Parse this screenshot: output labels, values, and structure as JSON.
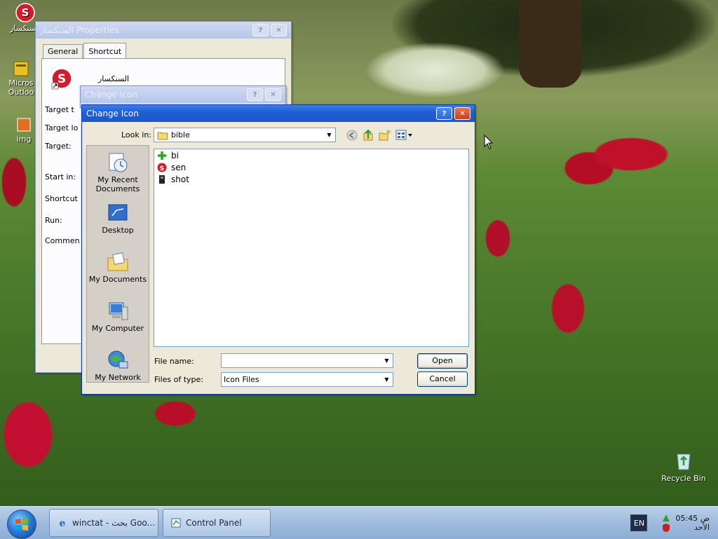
{
  "desktop": {
    "icons": [
      {
        "label": "السنكسار"
      },
      {
        "label": "Micros Outloo"
      },
      {
        "label": "img"
      },
      {
        "label": "Recycle Bin"
      }
    ]
  },
  "properties_window": {
    "title": "السنكسار Properties",
    "tabs": [
      "General",
      "Shortcut"
    ],
    "shortcut_name": "السنكسار",
    "labels": {
      "target_type": "Target t",
      "target_location": "Target lo",
      "target": "Target:",
      "start_in": "Start in:",
      "shortcut_key": "Shortcut",
      "run": "Run:",
      "comment": "Commen"
    }
  },
  "change_icon_bg": {
    "title": "Change Icon"
  },
  "open_dialog": {
    "title": "Change Icon",
    "look_in_label": "Look in:",
    "look_in_value": "bible",
    "places": [
      {
        "label": "My Recent Documents",
        "icon": "recent-documents-icon"
      },
      {
        "label": "Desktop",
        "icon": "desktop-icon"
      },
      {
        "label": "My Documents",
        "icon": "my-documents-icon"
      },
      {
        "label": "My Computer",
        "icon": "my-computer-icon"
      },
      {
        "label": "My Network",
        "icon": "my-network-icon"
      }
    ],
    "files": [
      {
        "name": "bi",
        "icon": "green-cross-icon"
      },
      {
        "name": "sen",
        "icon": "red-s-icon"
      },
      {
        "name": "shot",
        "icon": "black-file-icon"
      }
    ],
    "file_name_label": "File name:",
    "file_name_value": "",
    "files_of_type_label": "Files of type:",
    "files_of_type_value": "Icon Files",
    "open_label": "Open",
    "cancel_label": "Cancel",
    "help_label": "?",
    "close_label": "✕"
  },
  "taskbar": {
    "items": [
      {
        "label": "winctat - بحث Goo..."
      },
      {
        "label": "Control Panel"
      }
    ],
    "tray_lang": "EN",
    "clock_time": "05:45 ص",
    "clock_day": "الأحد"
  }
}
